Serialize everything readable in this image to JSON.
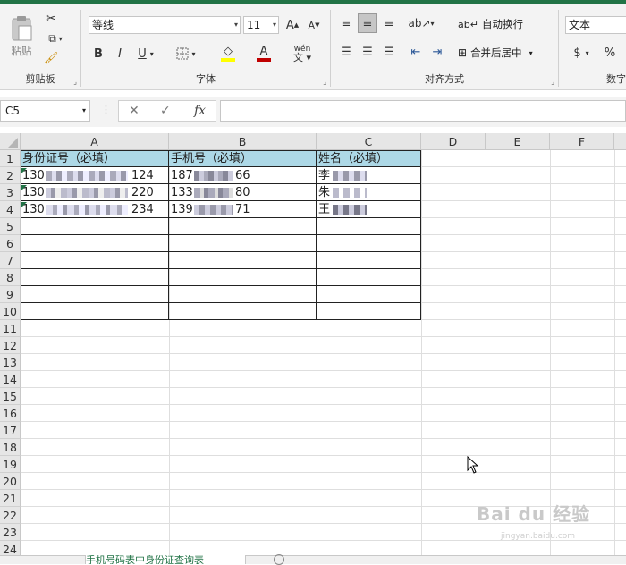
{
  "ribbon": {
    "clipboard": {
      "paste_label": "粘贴",
      "group_label": "剪贴板"
    },
    "font": {
      "font_name": "等线",
      "font_size": "11",
      "grow_label": "A",
      "shrink_label": "A",
      "bold": "B",
      "italic": "I",
      "underline": "U",
      "fill_color": "#ffff00",
      "font_color": "#c00000",
      "phonetic_label": "wén",
      "group_label": "字体"
    },
    "alignment": {
      "wrap_text": "自动换行",
      "merge_center": "合并后居中",
      "group_label": "对齐方式"
    },
    "number": {
      "format": "文本",
      "currency": "$",
      "percent": "%",
      "group_label": "数字"
    }
  },
  "formula_bar": {
    "name_box": "C5",
    "fx_label": "fx",
    "formula": ""
  },
  "columns": [
    "A",
    "B",
    "C",
    "D",
    "E",
    "F"
  ],
  "rows": [
    "1",
    "2",
    "3",
    "4",
    "5",
    "6",
    "7",
    "8",
    "9",
    "10",
    "11",
    "12",
    "13",
    "14",
    "15",
    "16",
    "17",
    "18",
    "19",
    "20",
    "21",
    "22",
    "23",
    "24"
  ],
  "cells": {
    "A1": "身份证号（必填）",
    "B1": "手机号（必填）",
    "C1": "姓名（必填）",
    "A2_prefix": "130",
    "A2_suffix": "124",
    "B2_prefix": "187",
    "B2_suffix": "66",
    "C2": "李",
    "A3_prefix": "130",
    "A3_suffix": "220",
    "B3_prefix": "133",
    "B3_suffix": "80",
    "C3": "朱",
    "A4_prefix": "130",
    "A4_suffix": "234",
    "B4_prefix": "139",
    "B4_suffix": "71",
    "C4": "王"
  },
  "sheet_tab": {
    "label": "手机号码表中身份证查询表"
  },
  "watermark": {
    "text": "Bai du 经验",
    "sub": "jingyan.baidu.com"
  },
  "colors": {
    "accent": "#217346",
    "header_fill": "#add8e6"
  }
}
